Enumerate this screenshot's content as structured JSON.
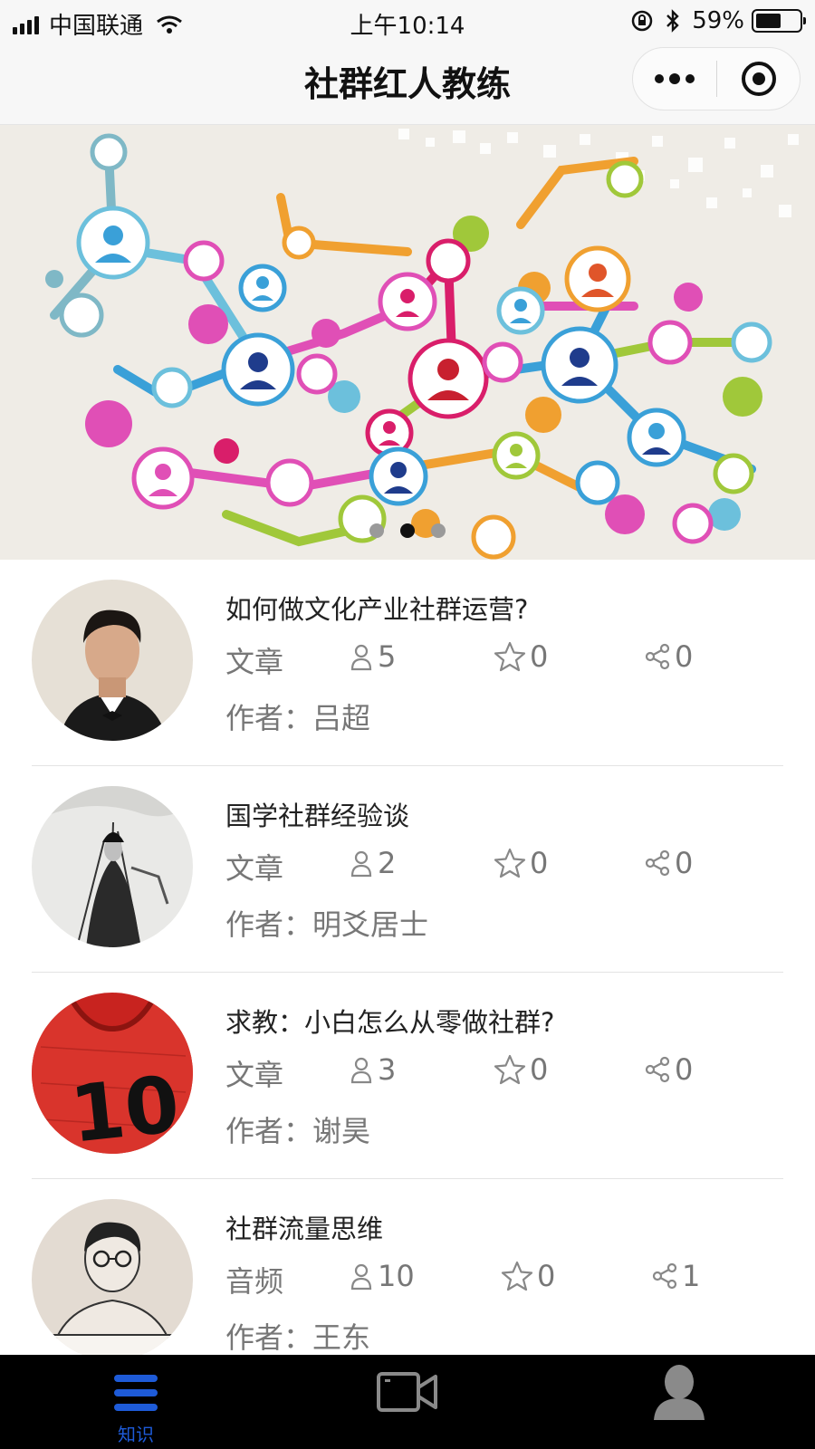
{
  "status_bar": {
    "carrier": "中国联通",
    "time": "上午10:14",
    "battery_percent": "59%",
    "battery_level": 0.59
  },
  "nav": {
    "title": "社群红人教练",
    "more_icon": "more-dots-icon",
    "close_icon": "target-ring-icon"
  },
  "banner": {
    "slide_count": 3,
    "active_slide": 1
  },
  "articles": [
    {
      "title": "如何做文化产业社群运营?",
      "type": "文章",
      "views": "5",
      "likes": "0",
      "shares": "0",
      "author": "作者：吕超"
    },
    {
      "title": "国学社群经验谈",
      "type": "文章",
      "views": "2",
      "likes": "0",
      "shares": "0",
      "author": "作者：明爻居士"
    },
    {
      "title": "求教：小白怎么从零做社群?",
      "type": "文章",
      "views": "3",
      "likes": "0",
      "shares": "0",
      "author": "作者：谢昊"
    },
    {
      "title": "社群流量思维",
      "type": "音频",
      "views": "10",
      "likes": "0",
      "shares": "1",
      "author": "作者：王东"
    }
  ],
  "tab_bar": {
    "tabs": [
      {
        "label": "知识",
        "icon": "menu-lines-icon",
        "active": true
      },
      {
        "label": "",
        "icon": "video-camera-icon",
        "active": false
      },
      {
        "label": "",
        "icon": "person-icon",
        "active": false
      }
    ]
  },
  "colors": {
    "accent_blue": "#1e5bd8",
    "meta_gray": "#777777",
    "tab_bar_bg": "#000000"
  }
}
